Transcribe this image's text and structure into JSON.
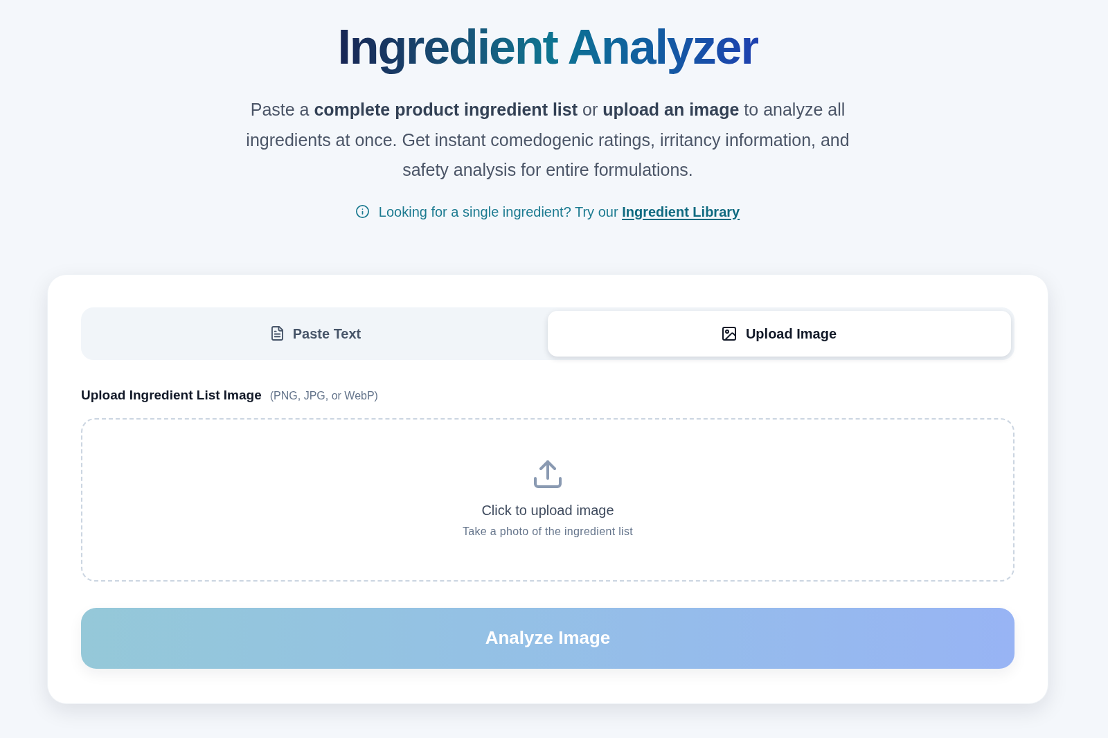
{
  "header": {
    "title": "Ingredient Analyzer",
    "description": "Paste a **complete product ingredient list** or **upload an image** to analyze all ingredients at once. Get instant comedogenic ratings, irritancy information, and safety analysis for entire formulations.",
    "hint": {
      "text": "Looking for a single ingredient? Try our",
      "link": "Ingredient Library"
    }
  },
  "tabs": [
    {
      "label": "Paste Text",
      "selected": false
    },
    {
      "label": "Upload Image",
      "selected": true
    }
  ],
  "upload": {
    "label": "Upload Ingredient List Image",
    "formats": "(PNG, JPG, or WebP)",
    "prompt": "Click to upload image",
    "subprompt": "Take a photo of the ingredient list"
  },
  "analyze_button": {
    "label": "Analyze Image",
    "disabled": true
  }
}
